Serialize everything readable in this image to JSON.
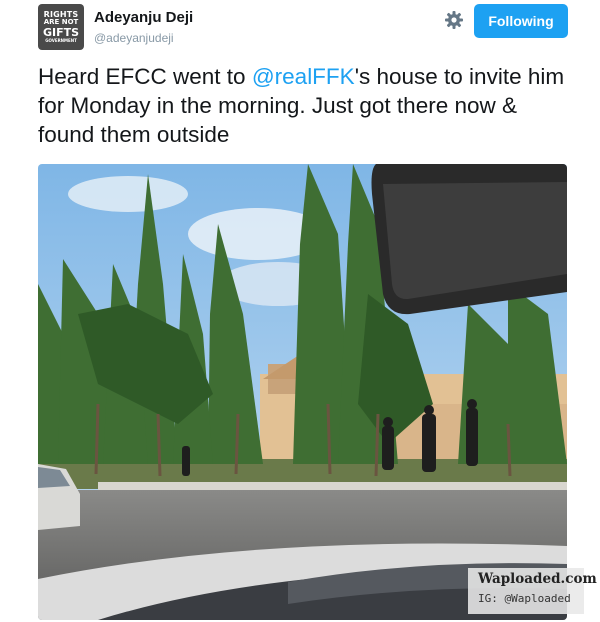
{
  "tweet": {
    "author": {
      "name": "Adeyanju Deji",
      "handle": "@adeyanjudeji",
      "avatar_text": [
        "RIGHTS",
        "ARE NOT",
        "GIFTS",
        "GOVERNMENT"
      ]
    },
    "settings_icon": "gear-icon",
    "follow_button": {
      "label": "Following",
      "color": "#1da1f2"
    },
    "text": {
      "part1": "Heard EFCC went to ",
      "mention": "@realFFK",
      "part2": "'s house to invite him for Monday in the morning. Just got there now & found them outside"
    },
    "mention_color": "#1da1f2"
  },
  "watermark": {
    "site": "Waploaded.com",
    "ig": "IG: @Waploaded"
  }
}
